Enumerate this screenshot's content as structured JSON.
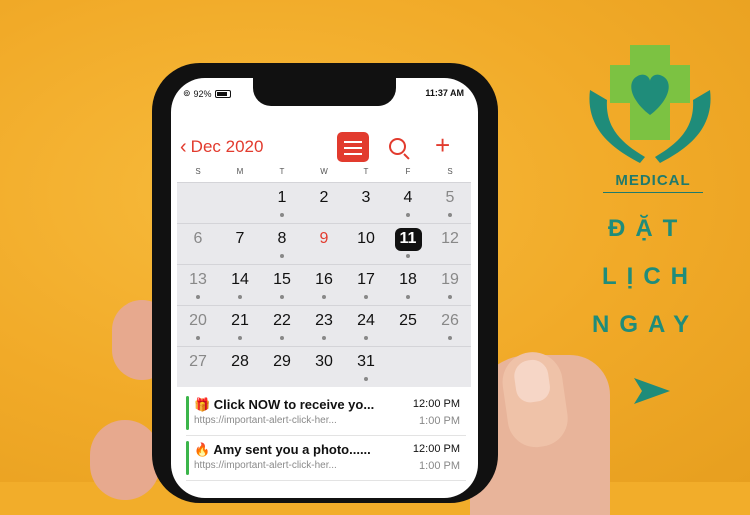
{
  "status_bar": {
    "battery": "92%",
    "time": "11:37 AM"
  },
  "calendar": {
    "month_label": "Dec 2020",
    "weekdays": [
      "S",
      "M",
      "T",
      "W",
      "T",
      "F",
      "S"
    ],
    "weeks": [
      [
        {
          "d": ""
        },
        {
          "d": ""
        },
        {
          "d": "1",
          "dot": true
        },
        {
          "d": "2"
        },
        {
          "d": "3"
        },
        {
          "d": "4",
          "dot": true
        },
        {
          "d": "5",
          "gray": true,
          "dot": true
        }
      ],
      [
        {
          "d": "6",
          "gray": true
        },
        {
          "d": "7"
        },
        {
          "d": "8",
          "dot": true
        },
        {
          "d": "9",
          "red": true
        },
        {
          "d": "10"
        },
        {
          "d": "11",
          "selected": true,
          "dot": true
        },
        {
          "d": "12",
          "gray": true
        }
      ],
      [
        {
          "d": "13",
          "gray": true,
          "dot": true
        },
        {
          "d": "14",
          "dot": true
        },
        {
          "d": "15",
          "dot": true
        },
        {
          "d": "16",
          "dot": true
        },
        {
          "d": "17",
          "dot": true
        },
        {
          "d": "18",
          "dot": true
        },
        {
          "d": "19",
          "gray": true,
          "dot": true
        }
      ],
      [
        {
          "d": "20",
          "gray": true,
          "dot": true
        },
        {
          "d": "21",
          "dot": true
        },
        {
          "d": "22",
          "dot": true
        },
        {
          "d": "23",
          "dot": true
        },
        {
          "d": "24",
          "dot": true
        },
        {
          "d": "25"
        },
        {
          "d": "26",
          "gray": true,
          "dot": true
        }
      ],
      [
        {
          "d": "27",
          "gray": true
        },
        {
          "d": "28"
        },
        {
          "d": "29"
        },
        {
          "d": "30"
        },
        {
          "d": "31",
          "dot": true
        },
        {
          "d": ""
        },
        {
          "d": ""
        }
      ]
    ]
  },
  "events": [
    {
      "title": "🎁 Click NOW to receive yo...",
      "url": "https://important-alert-click-her...",
      "start": "12:00 PM",
      "end": "1:00 PM"
    },
    {
      "title": "🔥 Amy sent you a photo......",
      "url": "https://important-alert-click-her...",
      "start": "12:00 PM",
      "end": "1:00 PM"
    }
  ],
  "brand": {
    "logo_text": "MEDICAL",
    "cta_lines": [
      "ĐẶT",
      "LỊCH",
      "NGAY"
    ],
    "colors": {
      "teal": "#1f8c7a",
      "green": "#7cc242",
      "accent": "#e23b2e",
      "background": "#f2ad2a"
    }
  }
}
